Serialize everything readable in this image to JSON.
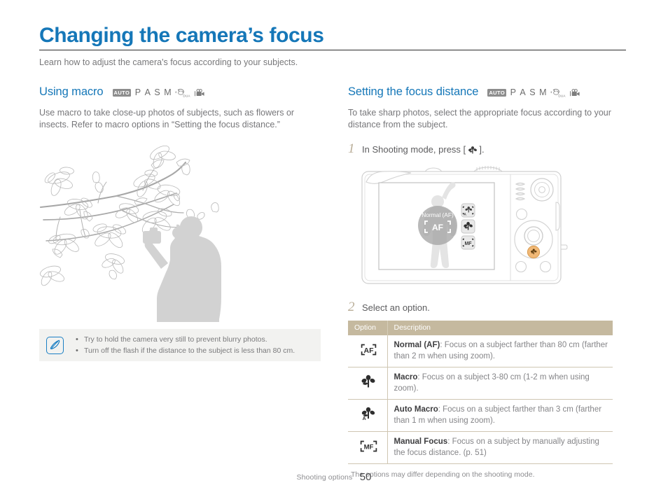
{
  "document": {
    "title": "Changing the camera’s focus",
    "subtitle": "Learn how to adjust the camera's focus according to your subjects.",
    "accent_color": "#1577b8",
    "rule_color": "#2b2b2b"
  },
  "mode_icons": {
    "auto_label": "AUTO",
    "letters": [
      "P",
      "A",
      "S",
      "M"
    ],
    "dual_label": "DUAL",
    "icons": [
      "auto-mode-icon",
      "p-mode-icon",
      "a-mode-icon",
      "s-mode-icon",
      "m-mode-icon",
      "dual-is-mode-icon",
      "movie-mode-icon"
    ]
  },
  "left_section": {
    "heading": "Using macro",
    "body": "Use macro to take close-up photos of subjects, such as flowers or insects. Refer to macro options in “Setting the focus distance.”",
    "illustration_name": "magnolia-branch-photographer-illustration",
    "note": {
      "icon": "note-pen-icon",
      "background_color": "#f2f2f0",
      "border_color": "#1b7fc4",
      "bullets": [
        "Try to hold the camera very still to prevent blurry photos.",
        "Turn off the flash if the distance to the subject is less than 80 cm."
      ]
    }
  },
  "right_section": {
    "heading": "Setting the focus distance",
    "body": "To take sharp photos, select the appropriate focus according to your distance from the subject.",
    "steps": [
      {
        "number": "1",
        "text_before": "In Shooting mode, press [",
        "icon": "macro-flower-icon",
        "text_after": "]."
      },
      {
        "number": "2",
        "text_before": "Select an option.",
        "icon": "",
        "text_after": ""
      }
    ],
    "camera": {
      "illustration_name": "camera-back-illustration",
      "lcd_label": "Normal (AF)",
      "lcd_center_icon": "af-focus-icon",
      "lcd_side_icons": [
        "auto-macro-icon",
        "macro-flower-icon",
        "manual-focus-icon"
      ],
      "highlight_button": "macro-button-highlight",
      "highlight_color": "#e8a355"
    },
    "table": {
      "header_background": "#c5b99f",
      "columns": [
        "Option",
        "Description"
      ],
      "rows": [
        {
          "icon": "af-focus-icon",
          "title": "Normal (AF)",
          "description": ": Focus on a subject farther than 80 cm (farther than 2 m when using zoom)."
        },
        {
          "icon": "macro-flower-icon",
          "title": "Macro",
          "description": ": Focus on a subject 3-80 cm (1-2 m when using zoom)."
        },
        {
          "icon": "auto-macro-icon",
          "title": "Auto Macro",
          "description": ": Focus on a subject farther than 3 cm (farther than 1 m when using zoom)."
        },
        {
          "icon": "manual-focus-icon",
          "title": "Manual Focus",
          "description": ": Focus on a subject by manually adjusting the focus distance. (p. 51)"
        }
      ],
      "footnote": "The options may differ depending on the shooting mode."
    }
  },
  "footer": {
    "label": "Shooting options",
    "page_number": "50"
  }
}
